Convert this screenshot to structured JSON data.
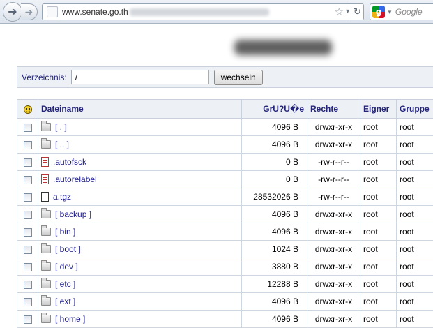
{
  "browser": {
    "url_visible": "www.senate.go.th",
    "search_placeholder": "Google",
    "icons": {
      "back": "back-arrow-icon",
      "forward": "forward-arrow-icon",
      "bookmark": "star-icon",
      "reload": "reload-icon",
      "search_engine": "google-icon"
    }
  },
  "directory": {
    "label": "Verzeichnis:",
    "value": "/",
    "button_label": "wechseln"
  },
  "table": {
    "headers": {
      "name": "Dateiname",
      "size": "GrU?U�e",
      "perms": "Rechte",
      "owner": "Eigner",
      "group": "Gruppe"
    },
    "rows": [
      {
        "icon": "folder-icon",
        "name": "[ . ]",
        "size": "4096 B",
        "perms": "drwxr-xr-x",
        "owner": "root",
        "group": "root"
      },
      {
        "icon": "folder-icon",
        "name": "[ .. ]",
        "size": "4096 B",
        "perms": "drwxr-xr-x",
        "owner": "root",
        "group": "root"
      },
      {
        "icon": "file-icon",
        "name": ".autofsck",
        "size": "0 B",
        "perms": "-rw-r--r--",
        "owner": "root",
        "group": "root"
      },
      {
        "icon": "file-icon",
        "name": ".autorelabel",
        "size": "0 B",
        "perms": "-rw-r--r--",
        "owner": "root",
        "group": "root"
      },
      {
        "icon": "archive-icon",
        "name": "a.tgz",
        "size": "28532026 B",
        "perms": "-rw-r--r--",
        "owner": "root",
        "group": "root"
      },
      {
        "icon": "folder-icon",
        "name": "[ backup ]",
        "size": "4096 B",
        "perms": "drwxr-xr-x",
        "owner": "root",
        "group": "root"
      },
      {
        "icon": "folder-icon",
        "name": "[ bin ]",
        "size": "4096 B",
        "perms": "drwxr-xr-x",
        "owner": "root",
        "group": "root"
      },
      {
        "icon": "folder-icon",
        "name": "[ boot ]",
        "size": "1024 B",
        "perms": "drwxr-xr-x",
        "owner": "root",
        "group": "root"
      },
      {
        "icon": "folder-icon",
        "name": "[ dev ]",
        "size": "3880 B",
        "perms": "drwxr-xr-x",
        "owner": "root",
        "group": "root"
      },
      {
        "icon": "folder-icon",
        "name": "[ etc ]",
        "size": "12288 B",
        "perms": "drwxr-xr-x",
        "owner": "root",
        "group": "root"
      },
      {
        "icon": "folder-icon",
        "name": "[ ext ]",
        "size": "4096 B",
        "perms": "drwxr-xr-x",
        "owner": "root",
        "group": "root"
      },
      {
        "icon": "folder-icon",
        "name": "[ home ]",
        "size": "4096 B",
        "perms": "drwxr-xr-x",
        "owner": "root",
        "group": "root"
      }
    ]
  },
  "colors": {
    "header_text": "#23237a",
    "link": "#1a1a8a",
    "header_bg": "#edf1f6",
    "border": "#c9d2dc"
  }
}
